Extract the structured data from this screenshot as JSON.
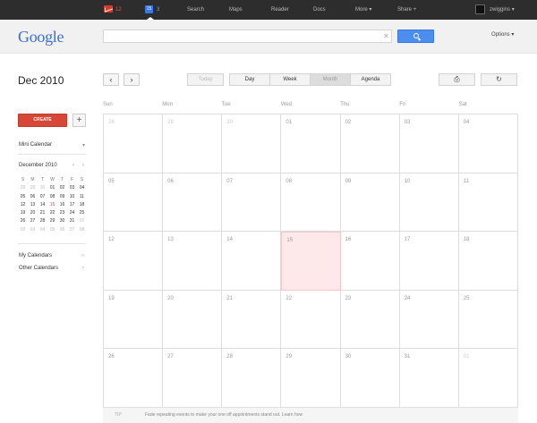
{
  "topbar": {
    "mail_count": "12",
    "calendar_icon_day": "15",
    "calendar_count": "3",
    "search_label": "Search",
    "maps_label": "Maps",
    "reader_label": "Reader",
    "docs_label": "Docs",
    "more_label": "More",
    "share_label": "Share",
    "username": "zwiggins",
    "mail_color": "#d93b2b",
    "calendar_color": "#3b78e7"
  },
  "header": {
    "logo_text": "Google",
    "options_label": "Options",
    "search_placeholder": ""
  },
  "toolbar": {
    "date_title": "Dec 2010",
    "today_label": "Today",
    "day_label": "Day",
    "week_label": "Week",
    "month_label": "Month",
    "agenda_label": "Agenda"
  },
  "sidebar": {
    "create_label": "CREATE",
    "plus_label": "+",
    "mini_calendar_label": "Mini Calendar",
    "mini_month_label": "December 2010",
    "my_calendars_label": "My Calendars",
    "other_calendars_label": "Other Calendars",
    "mini_dow": [
      "S",
      "M",
      "T",
      "W",
      "T",
      "F",
      "S"
    ],
    "mini_weeks": [
      [
        "28",
        "29",
        "30",
        "01",
        "02",
        "03",
        "04"
      ],
      [
        "05",
        "06",
        "07",
        "08",
        "09",
        "10",
        "11"
      ],
      [
        "12",
        "13",
        "14",
        "15",
        "16",
        "17",
        "18"
      ],
      [
        "19",
        "20",
        "21",
        "22",
        "23",
        "24",
        "25"
      ],
      [
        "26",
        "27",
        "28",
        "29",
        "30",
        "31",
        "01"
      ],
      [
        "02",
        "03",
        "04",
        "05",
        "06",
        "07",
        "08"
      ]
    ],
    "today": "15",
    "accent_color": "#d64737"
  },
  "calendar": {
    "day_headers": [
      "Sun",
      "Mon",
      "Tue",
      "Wed",
      "Thu",
      "Fri",
      "Sat"
    ],
    "weeks": [
      [
        "28",
        "29",
        "30",
        "01",
        "02",
        "03",
        "04"
      ],
      [
        "05",
        "06",
        "07",
        "08",
        "09",
        "10",
        "11"
      ],
      [
        "12",
        "13",
        "14",
        "15",
        "16",
        "17",
        "18"
      ],
      [
        "19",
        "20",
        "21",
        "22",
        "23",
        "24",
        "25"
      ],
      [
        "26",
        "27",
        "28",
        "29",
        "30",
        "31",
        "01"
      ]
    ],
    "today": "15",
    "today_color": "#fde9e9"
  },
  "tip": {
    "label": "TIP",
    "text": "Fade repeating events to make your one off appointments stand out. Learn how"
  }
}
